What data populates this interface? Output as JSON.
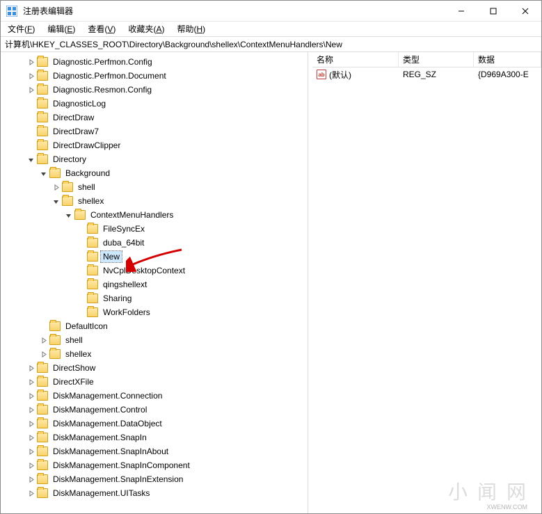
{
  "window": {
    "title": "注册表编辑器",
    "controls": {
      "minimize": "–",
      "maximize": "□",
      "close": "×"
    }
  },
  "menubar": {
    "file": {
      "label": "文件",
      "mnemonic": "F"
    },
    "edit": {
      "label": "编辑",
      "mnemonic": "E"
    },
    "view": {
      "label": "查看",
      "mnemonic": "V"
    },
    "favorites": {
      "label": "收藏夹",
      "mnemonic": "A"
    },
    "help": {
      "label": "帮助",
      "mnemonic": "H"
    }
  },
  "addressbar": {
    "path": "计算机\\HKEY_CLASSES_ROOT\\Directory\\Background\\shellex\\ContextMenuHandlers\\New"
  },
  "tree": {
    "items": [
      {
        "depth": 2,
        "expandable": true,
        "expanded": false,
        "label": "Diagnostic.Perfmon.Config"
      },
      {
        "depth": 2,
        "expandable": true,
        "expanded": false,
        "label": "Diagnostic.Perfmon.Document"
      },
      {
        "depth": 2,
        "expandable": true,
        "expanded": false,
        "label": "Diagnostic.Resmon.Config"
      },
      {
        "depth": 2,
        "expandable": false,
        "expanded": false,
        "label": "DiagnosticLog"
      },
      {
        "depth": 2,
        "expandable": false,
        "expanded": false,
        "label": "DirectDraw"
      },
      {
        "depth": 2,
        "expandable": false,
        "expanded": false,
        "label": "DirectDraw7"
      },
      {
        "depth": 2,
        "expandable": false,
        "expanded": false,
        "label": "DirectDrawClipper"
      },
      {
        "depth": 2,
        "expandable": true,
        "expanded": true,
        "label": "Directory"
      },
      {
        "depth": 3,
        "expandable": true,
        "expanded": true,
        "label": "Background"
      },
      {
        "depth": 4,
        "expandable": true,
        "expanded": false,
        "label": "shell"
      },
      {
        "depth": 4,
        "expandable": true,
        "expanded": true,
        "label": "shellex"
      },
      {
        "depth": 5,
        "expandable": true,
        "expanded": true,
        "label": "ContextMenuHandlers"
      },
      {
        "depth": 6,
        "expandable": false,
        "expanded": false,
        "label": " FileSyncEx"
      },
      {
        "depth": 6,
        "expandable": false,
        "expanded": false,
        "label": "duba_64bit"
      },
      {
        "depth": 6,
        "expandable": false,
        "expanded": false,
        "label": "New",
        "selected": true
      },
      {
        "depth": 6,
        "expandable": false,
        "expanded": false,
        "label": "NvCplDesktopContext"
      },
      {
        "depth": 6,
        "expandable": false,
        "expanded": false,
        "label": "qingshellext"
      },
      {
        "depth": 6,
        "expandable": false,
        "expanded": false,
        "label": "Sharing"
      },
      {
        "depth": 6,
        "expandable": false,
        "expanded": false,
        "label": "WorkFolders"
      },
      {
        "depth": 3,
        "expandable": false,
        "expanded": false,
        "label": "DefaultIcon"
      },
      {
        "depth": 3,
        "expandable": true,
        "expanded": false,
        "label": "shell"
      },
      {
        "depth": 3,
        "expandable": true,
        "expanded": false,
        "label": "shellex"
      },
      {
        "depth": 2,
        "expandable": true,
        "expanded": false,
        "label": "DirectShow"
      },
      {
        "depth": 2,
        "expandable": true,
        "expanded": false,
        "label": "DirectXFile"
      },
      {
        "depth": 2,
        "expandable": true,
        "expanded": false,
        "label": "DiskManagement.Connection"
      },
      {
        "depth": 2,
        "expandable": true,
        "expanded": false,
        "label": "DiskManagement.Control"
      },
      {
        "depth": 2,
        "expandable": true,
        "expanded": false,
        "label": "DiskManagement.DataObject"
      },
      {
        "depth": 2,
        "expandable": true,
        "expanded": false,
        "label": "DiskManagement.SnapIn"
      },
      {
        "depth": 2,
        "expandable": true,
        "expanded": false,
        "label": "DiskManagement.SnapInAbout"
      },
      {
        "depth": 2,
        "expandable": true,
        "expanded": false,
        "label": "DiskManagement.SnapInComponent"
      },
      {
        "depth": 2,
        "expandable": true,
        "expanded": false,
        "label": "DiskManagement.SnapInExtension"
      },
      {
        "depth": 2,
        "expandable": true,
        "expanded": false,
        "label": "DiskManagement.UITasks"
      }
    ]
  },
  "list": {
    "columns": {
      "name": "名称",
      "type": "类型",
      "data": "数据"
    },
    "rows": [
      {
        "icon": "reg-sz",
        "name": "(默认)",
        "type": "REG_SZ",
        "data": "{D969A300-E"
      }
    ]
  },
  "watermark": {
    "main": "小闻网",
    "sub": "XWENW.COM"
  }
}
